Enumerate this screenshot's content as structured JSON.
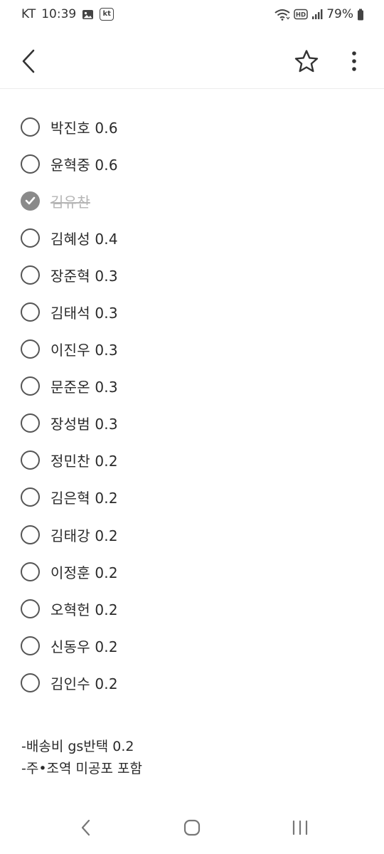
{
  "status_bar": {
    "carrier": "KT",
    "time": "10:39",
    "kt_badge": "kt",
    "network_label": "HD",
    "battery": "79%",
    "icons": [
      "image-icon",
      "kt-badge-icon",
      "wifi-icon",
      "hd-voice-icon",
      "signal-icon",
      "battery-icon"
    ]
  },
  "toolbar": {
    "back_icon": "chevron-left-icon",
    "favorite_icon": "star-outline-icon",
    "more_icon": "more-vertical-icon"
  },
  "checklist": {
    "items": [
      {
        "text": "박진호 0.6",
        "checked": false
      },
      {
        "text": "윤혁중 0.6",
        "checked": false
      },
      {
        "text": "김유찬",
        "checked": true
      },
      {
        "text": "김혜성 0.4",
        "checked": false
      },
      {
        "text": "장준혁 0.3",
        "checked": false
      },
      {
        "text": "김태석 0.3",
        "checked": false
      },
      {
        "text": "이진우 0.3",
        "checked": false
      },
      {
        "text": "문준온 0.3",
        "checked": false
      },
      {
        "text": "장성범 0.3",
        "checked": false
      },
      {
        "text": "정민찬 0.2",
        "checked": false
      },
      {
        "text": "김은혁 0.2",
        "checked": false
      },
      {
        "text": "김태강 0.2",
        "checked": false
      },
      {
        "text": "이정훈 0.2",
        "checked": false
      },
      {
        "text": "오혁헌 0.2",
        "checked": false
      },
      {
        "text": "신동우 0.2",
        "checked": false
      },
      {
        "text": "김인수 0.2",
        "checked": false
      }
    ]
  },
  "notes": {
    "lines": [
      "-배송비 gs반택 0.2",
      "-주•조역 미공포 포함"
    ]
  },
  "navbar": {
    "icons": [
      "back-nav-icon",
      "home-nav-icon",
      "recents-nav-icon"
    ]
  },
  "colors": {
    "checked_fill": "#8a8a8a",
    "done_text": "#b5b5b5",
    "text": "#2a2a2a"
  }
}
